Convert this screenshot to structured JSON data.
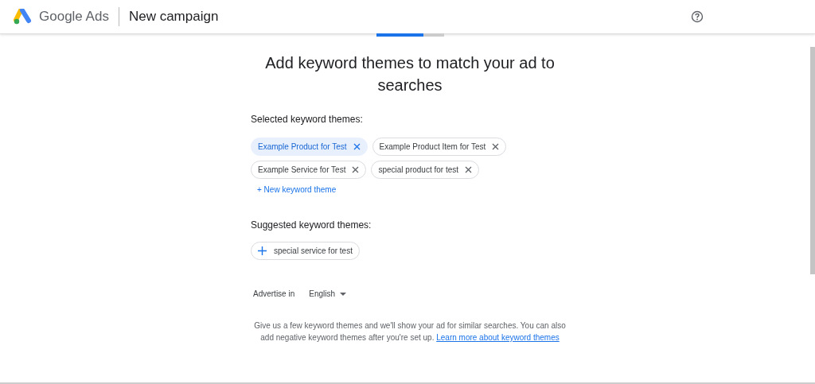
{
  "header": {
    "product": "Google Ads",
    "title": "New campaign"
  },
  "progress": {
    "level": 0.7
  },
  "heading": "Add keyword themes to match your ad to searches",
  "selected_section": {
    "label": "Selected keyword themes:",
    "chips": [
      {
        "label": "Example Product for Test",
        "selected": true
      },
      {
        "label": "Example Product Item for Test",
        "selected": false
      },
      {
        "label": "Example Service for Test",
        "selected": false
      },
      {
        "label": "special product for test",
        "selected": false
      }
    ],
    "add_link": "+ New keyword theme"
  },
  "suggested_section": {
    "label": "Suggested keyword themes:",
    "chips": [
      {
        "label": "special service for test"
      }
    ]
  },
  "language": {
    "label": "Advertise in",
    "value": "English"
  },
  "help_text": "Give us a few keyword themes and we'll show your ad for similar searches. You can also add negative keyword themes after you're set up.",
  "help_link": "Learn more about keyword themes"
}
